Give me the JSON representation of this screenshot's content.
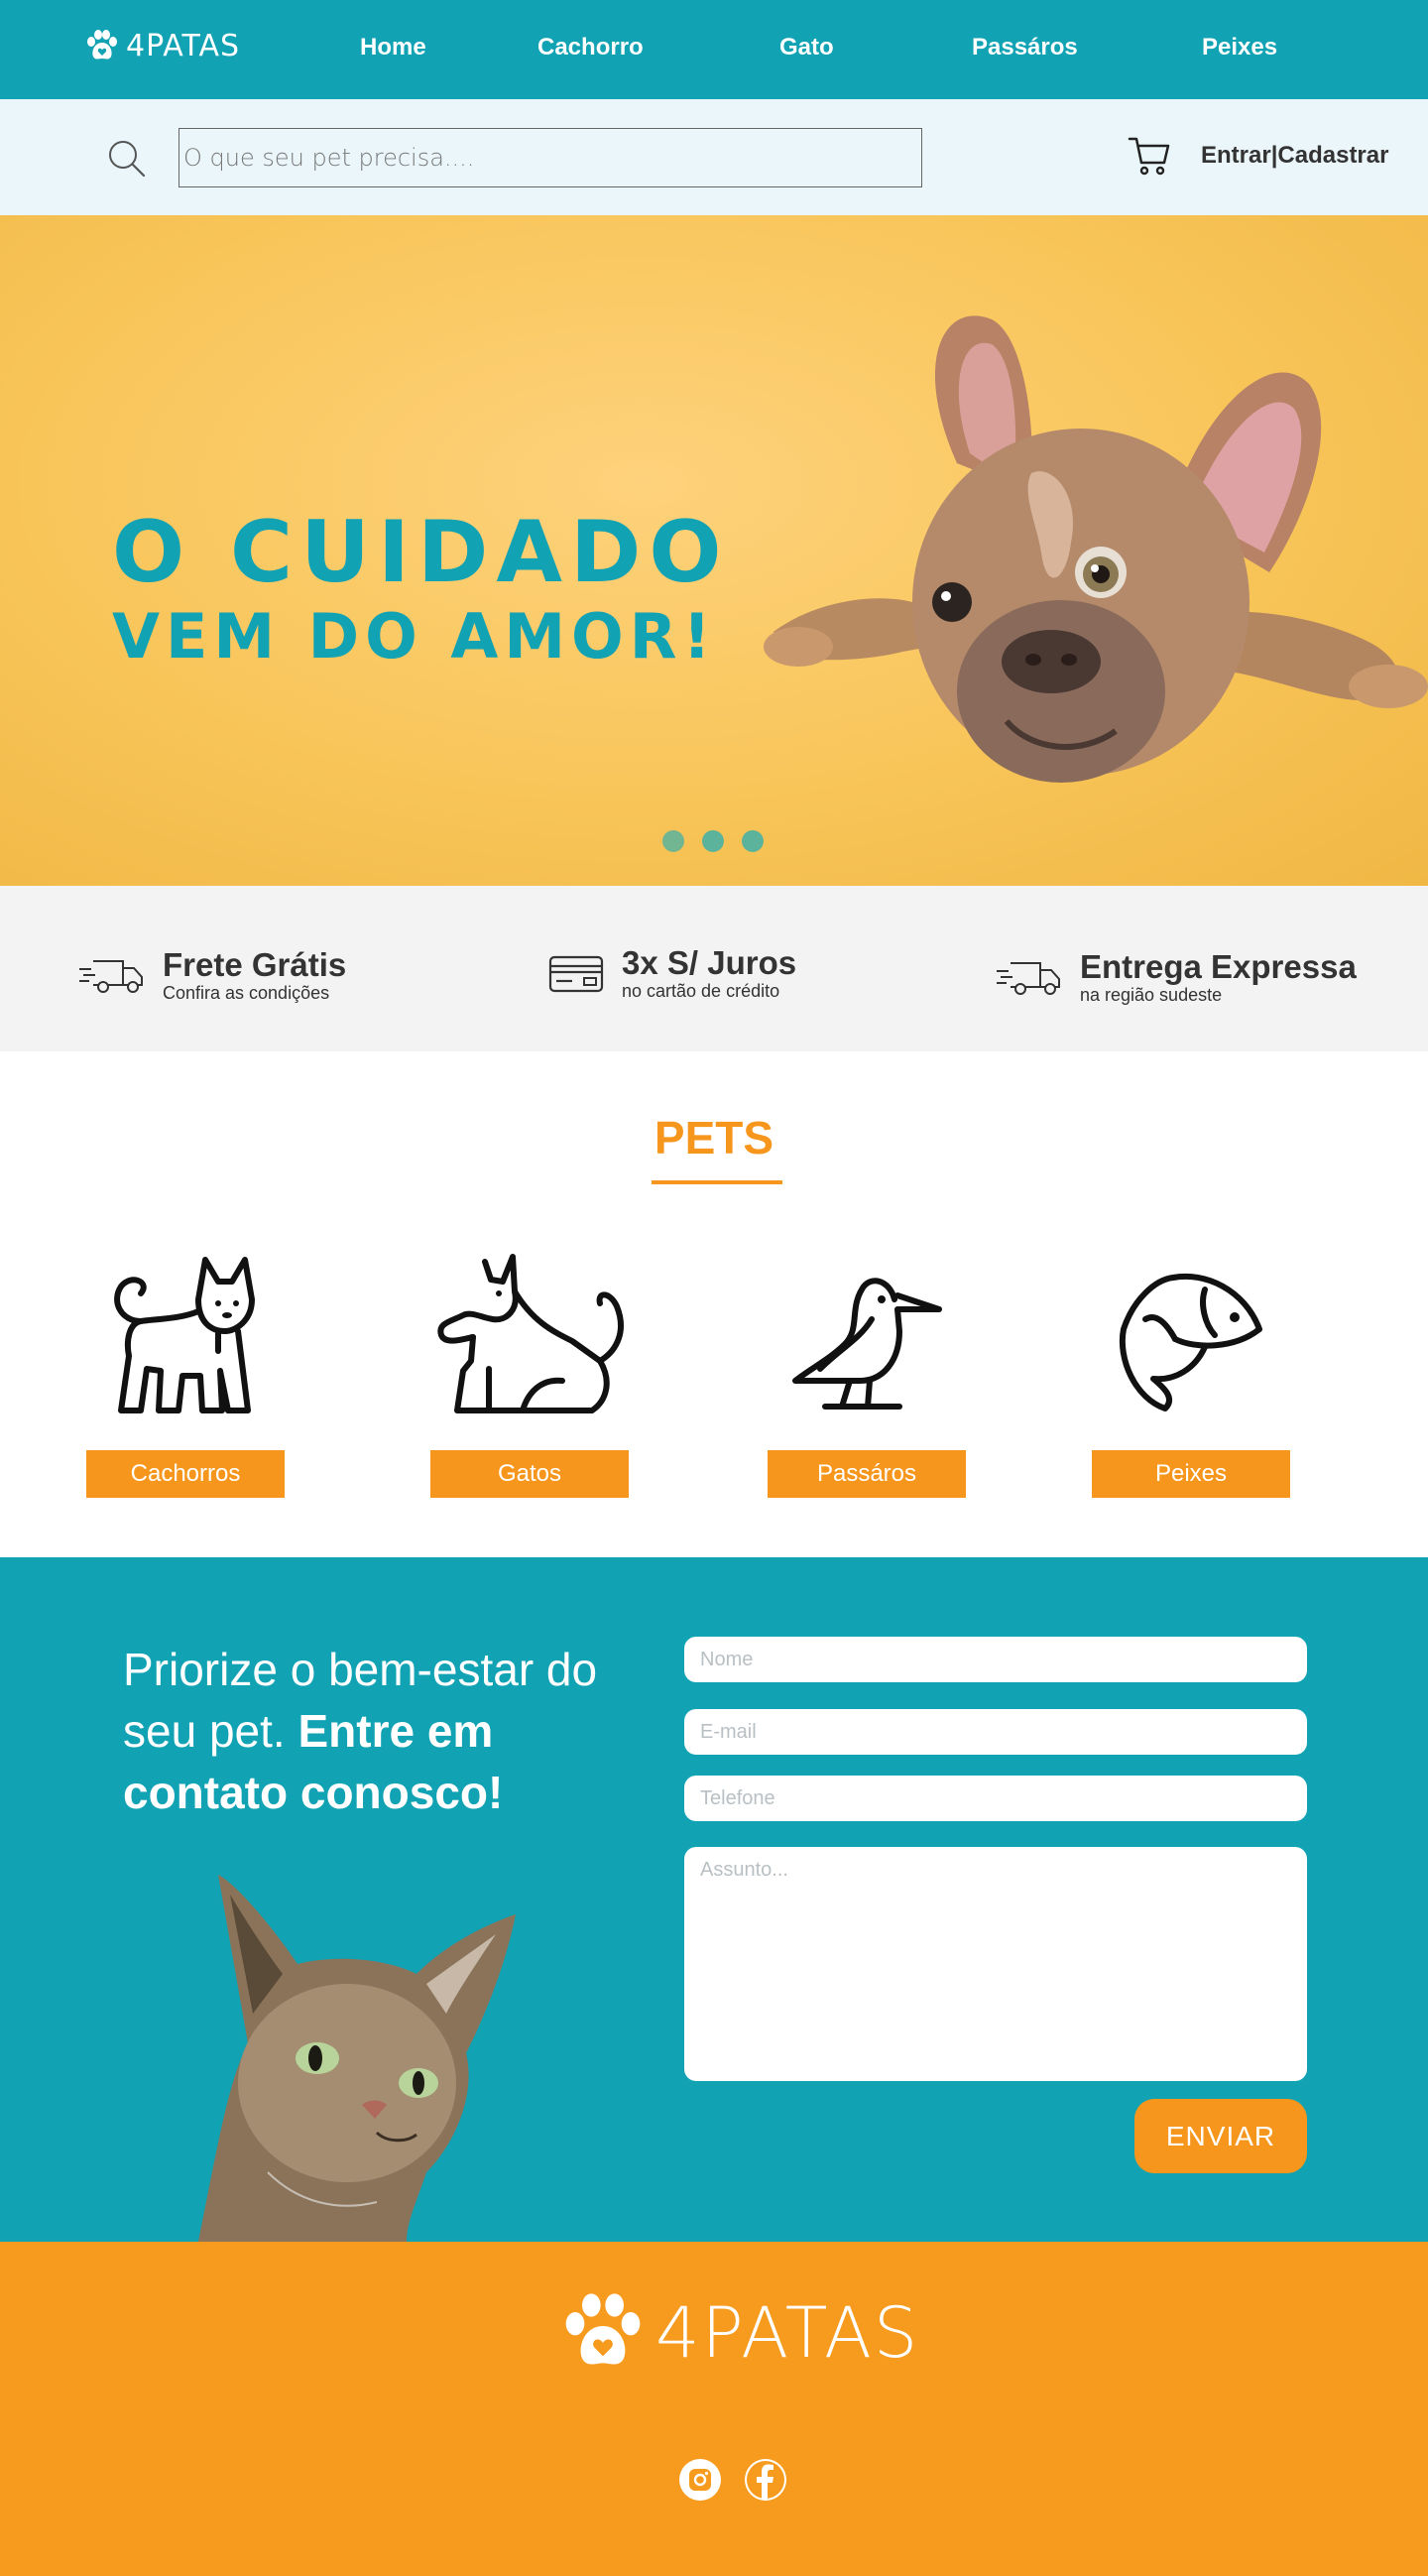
{
  "brand": {
    "name": "4PATAS"
  },
  "nav": {
    "items": [
      "Home",
      "Cachorro",
      "Gato",
      "Passáros",
      "Peixes"
    ]
  },
  "search": {
    "placeholder": "O que seu pet precisa...."
  },
  "auth": {
    "label": "Entrar|Cadastrar"
  },
  "hero": {
    "line1": "O CUIDADO",
    "line2": "VEM DO AMOR!",
    "slides": 3,
    "active_slide": 1
  },
  "features": [
    {
      "icon": "delivery-truck-icon",
      "title": "Frete Grátis",
      "subtitle": "Confira as condições"
    },
    {
      "icon": "credit-card-icon",
      "title": "3x S/ Juros",
      "subtitle": "no cartão de crédito"
    },
    {
      "icon": "delivery-truck-icon",
      "title": "Entrega Expressa",
      "subtitle": "na região sudeste"
    }
  ],
  "pets": {
    "title": "PETS",
    "items": [
      {
        "icon": "dog-icon",
        "label": "Cachorros"
      },
      {
        "icon": "cat-icon",
        "label": "Gatos"
      },
      {
        "icon": "bird-icon",
        "label": "Passáros"
      },
      {
        "icon": "fish-icon",
        "label": "Peixes"
      }
    ]
  },
  "contact": {
    "line_regular": "Priorize o bem-estar do seu pet.",
    "line_bold": "Entre em contato conosco!",
    "fields": {
      "name": "Nome",
      "email": "E-mail",
      "phone": "Telefone",
      "subject": "Assunto..."
    },
    "submit": "ENVIAR"
  },
  "footer": {
    "logo": "4PATAS",
    "social": [
      "instagram-icon",
      "facebook-icon"
    ]
  },
  "colors": {
    "teal": "#11a2b4",
    "orange": "#f7961c",
    "yellow": "#f8c559",
    "light": "#eaf6f9"
  }
}
